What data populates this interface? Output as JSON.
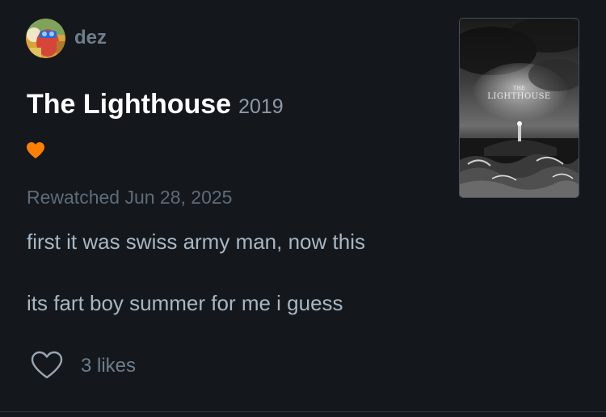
{
  "review": {
    "username": "dez",
    "film_title": "The Lighthouse",
    "film_year": "2019",
    "liked": true,
    "watch_date": "Rewatched Jun 28, 2025",
    "text_lines": [
      "first it was swiss army man, now this",
      "its fart boy summer for me i guess"
    ],
    "likes": "3 likes"
  },
  "poster": {
    "title_small": "THE",
    "title_big": "LIGHTHOUSE"
  },
  "icons": {
    "liked": "heart-icon",
    "like_action": "heart-outline-icon"
  },
  "colors": {
    "background": "#14181c",
    "heart": "#ff8000",
    "title": "#ffffff",
    "muted": "#6f7d8c",
    "body_text": "#a9b6c3"
  }
}
